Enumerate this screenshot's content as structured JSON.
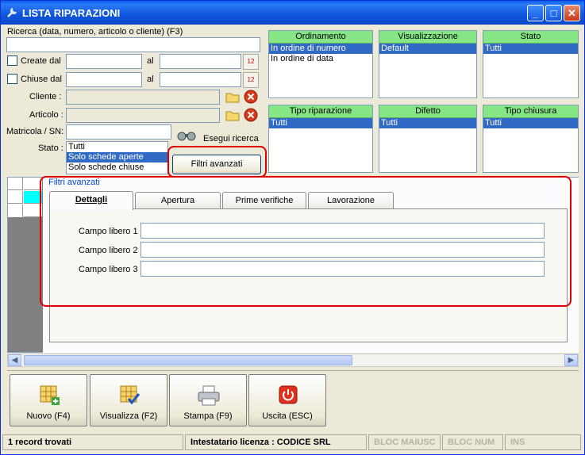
{
  "window": {
    "title": "LISTA RIPARAZIONI"
  },
  "search": {
    "label": "Ricerca (data, numero, articolo o cliente) (F3)",
    "value": "",
    "created_from_label": "Create dal",
    "closed_from_label": "Chiuse dal",
    "to_label": "al",
    "customer_label": "Cliente :",
    "article_label": "Articolo :",
    "serial_label": "Matricola / SN:",
    "state_label": "Stato :",
    "state_options": [
      "Tutti",
      "Solo schede aperte",
      "Solo schede chiuse"
    ],
    "state_selected": "Solo schede aperte",
    "execute_label": "Esegui ricerca",
    "advanced_filters_label": "Filtri avanzati"
  },
  "filters": {
    "ordinamento": {
      "title": "Ordinamento",
      "items": [
        "In ordine di numero",
        "In ordine di data"
      ],
      "selected": "In ordine di numero"
    },
    "visualizzazione": {
      "title": "Visualizzazione",
      "items": [
        "Default"
      ],
      "selected": "Default"
    },
    "stato": {
      "title": "Stato",
      "items": [
        "Tutti"
      ],
      "selected": "Tutti"
    },
    "tipo_riparazione": {
      "title": "Tipo riparazione",
      "items": [
        "Tutti"
      ],
      "selected": "Tutti"
    },
    "difetto": {
      "title": "Difetto",
      "items": [
        "Tutti"
      ],
      "selected": "Tutti"
    },
    "tipo_chiusura": {
      "title": "Tipo chiusura",
      "items": [
        "Tutti"
      ],
      "selected": "Tutti"
    }
  },
  "advanced": {
    "group_label": "Filtri avanzati",
    "tabs": [
      "Dettagli",
      "Apertura",
      "Prime verifiche",
      "Lavorazione"
    ],
    "active_tab": "Dettagli",
    "fields": [
      {
        "label": "Campo libero 1 :",
        "value": ""
      },
      {
        "label": "Campo libero 2 :",
        "value": ""
      },
      {
        "label": "Campo libero 3 :",
        "value": ""
      }
    ]
  },
  "toolbar": {
    "new_label": "Nuovo (F4)",
    "view_label": "Visualizza (F2)",
    "print_label": "Stampa (F9)",
    "exit_label": "Uscita (ESC)"
  },
  "statusbar": {
    "records": "1 record trovati",
    "license": "Intestatario licenza : CODICE SRL",
    "caps": "BLOC MAIUSC",
    "num": "BLOC NUM",
    "ins": "INS"
  },
  "icons": {
    "app": "wrench-icon",
    "calendar": "calendar-icon",
    "folder": "folder-icon",
    "clear": "clear-icon",
    "search": "binoculars-icon",
    "new": "grid-add-icon",
    "view": "grid-check-icon",
    "print": "printer-icon",
    "exit": "power-icon"
  },
  "colors": {
    "list_header": "#86e686",
    "selection": "#316ac5",
    "highlight": "#e00000"
  }
}
